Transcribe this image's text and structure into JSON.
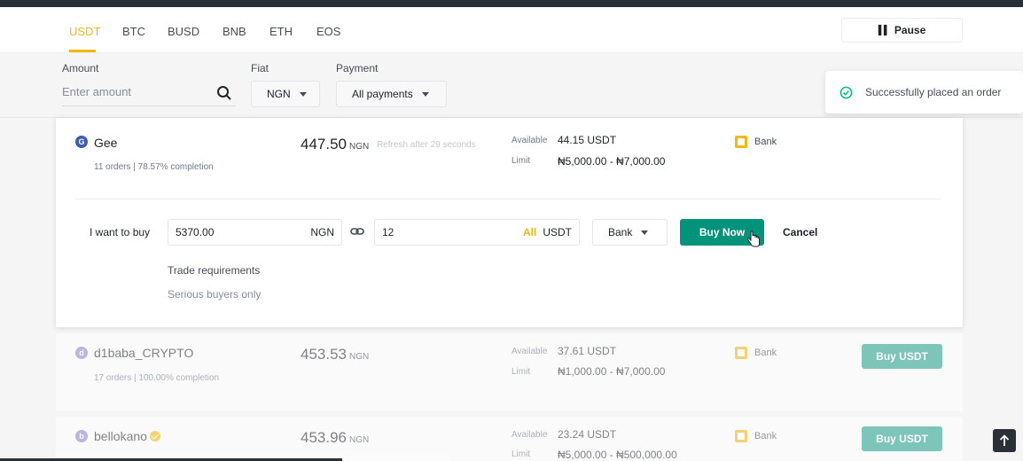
{
  "tabs": [
    "USDT",
    "BTC",
    "BUSD",
    "BNB",
    "ETH",
    "EOS"
  ],
  "active_tab": "USDT",
  "pause_label": "Pause",
  "filters": {
    "amount_label": "Amount",
    "amount_placeholder": "Enter amount",
    "fiat_label": "Fiat",
    "fiat_value": "NGN",
    "payment_label": "Payment",
    "payment_value": "All payments"
  },
  "toast": {
    "message": "Successfully placed an order"
  },
  "selected": {
    "avatar_letter": "G",
    "name": "Gee",
    "stats": "11 orders | 78.57% completion",
    "price": "447.50",
    "price_currency": "NGN",
    "refresh_note": "Refresh after 29 seconds",
    "available_label": "Available",
    "available_value": "44.15 USDT",
    "limit_label": "Limit",
    "limit_value": "₦5,000.00 - ₦7,000.00",
    "payment": "Bank",
    "buy_form": {
      "label": "I want to buy",
      "fiat_amount": "5370.00",
      "fiat_currency": "NGN",
      "crypto_amount": "12",
      "all_label": "All",
      "crypto_currency": "USDT",
      "payment_method": "Bank",
      "buy_now_label": "Buy Now",
      "cancel_label": "Cancel"
    },
    "trade_requirements_title": "Trade requirements",
    "trade_requirements_text": "Serious buyers only"
  },
  "rows": [
    {
      "avatar_letter": "d",
      "name": "d1baba_CRYPTO",
      "stats": "17 orders | 100.00% completion",
      "price": "453.53",
      "price_currency": "NGN",
      "available_label": "Available",
      "available_value": "37.61 USDT",
      "limit_label": "Limit",
      "limit_value": "₦1,000.00 - ₦7,000.00",
      "payment": "Bank",
      "button_label": "Buy USDT"
    },
    {
      "avatar_letter": "b",
      "name": "bellokano",
      "stats": "",
      "price": "453.96",
      "price_currency": "NGN",
      "available_label": "Available",
      "available_value": "23.24 USDT",
      "limit_label": "Limit",
      "limit_value": "₦5,000.00 - ₦500,000.00",
      "payment": "Bank",
      "button_label": "Buy USDT"
    }
  ],
  "colors": {
    "accent": "#f0b90b",
    "buy_green": "#02947b",
    "success": "#02c076",
    "avatar_blue": "#3d5ab4",
    "avatar_purple": "#8a7fd0"
  },
  "icons": [
    "pause-icon",
    "search-icon",
    "chevron-down-icon",
    "check-circle-icon",
    "link-icon",
    "bank-icon",
    "cursor-hand-icon",
    "verified-badge-icon",
    "arrow-up-icon"
  ]
}
